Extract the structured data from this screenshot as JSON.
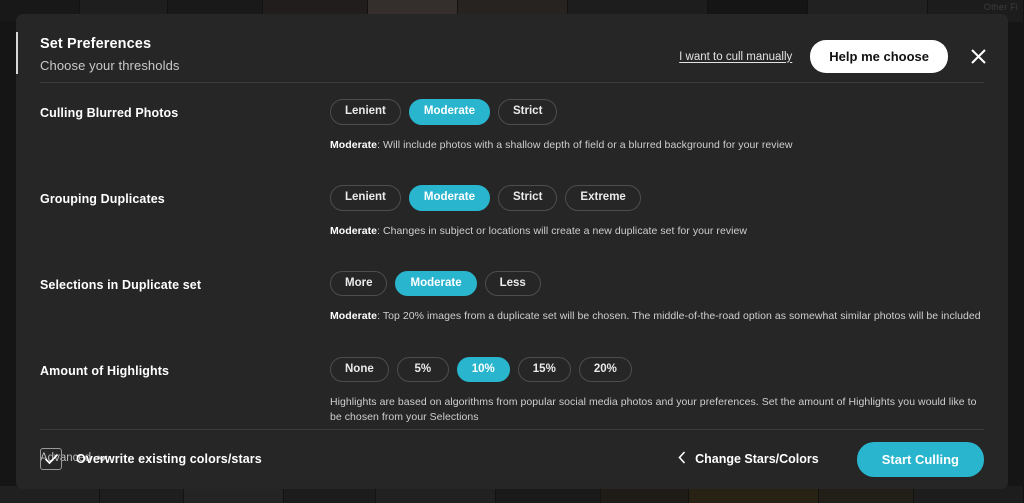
{
  "background": {
    "top_strip_label": "Other Fi",
    "top_thumbs": [
      "#1d1d1d",
      "#232323",
      "#151515",
      "#1e1e1e",
      "#2a2622",
      "#3a3230",
      "#241f1e",
      "#1a1a1a",
      "#202020",
      "#191919"
    ],
    "bottom_thumbs": [
      "#1e1e1e",
      "#242018",
      "#2a2414",
      "#211d17",
      "#1b1b1b",
      "#232323",
      "#1d1d1d",
      "#262626",
      "#1f1f1f",
      "#222222"
    ]
  },
  "header": {
    "title": "Set Preferences",
    "subtitle": "Choose your thresholds",
    "manual_link": "I want to cull manually",
    "help_button": "Help me choose",
    "close_icon": "close-icon"
  },
  "options": [
    {
      "label": "Culling Blurred Photos",
      "choices": [
        "Lenient",
        "Moderate",
        "Strict"
      ],
      "selected": "Moderate",
      "desc_lead": "Moderate",
      "desc_text": ": Will include photos with a shallow depth of field or a blurred background for your review"
    },
    {
      "label": "Grouping Duplicates",
      "choices": [
        "Lenient",
        "Moderate",
        "Strict",
        "Extreme"
      ],
      "selected": "Moderate",
      "desc_lead": "Moderate",
      "desc_text": ": Changes in subject or locations will create a new duplicate set for your review"
    },
    {
      "label": "Selections in Duplicate set",
      "choices": [
        "More",
        "Moderate",
        "Less"
      ],
      "selected": "Moderate",
      "desc_lead": "Moderate",
      "desc_text": ": Top 20% images from a duplicate set will be chosen. The middle-of-the-road option as somewhat similar photos will be included"
    },
    {
      "label": "Amount of Highlights",
      "choices": [
        "None",
        "5%",
        "10%",
        "15%",
        "20%"
      ],
      "selected": "10%",
      "desc_lead": "",
      "desc_text": "Highlights are based on algorithms from popular social media photos and your preferences. Set the amount of Highlights you would like to be chosen from your Selections"
    }
  ],
  "advanced": {
    "label": "Advanced",
    "icon": "chevron-down-icon"
  },
  "footer": {
    "checkbox_label": "Overwrite existing colors/stars",
    "checkbox_checked": true,
    "back_label": "Change Stars/Colors",
    "back_icon": "chevron-left-icon",
    "primary_button": "Start Culling"
  },
  "colors": {
    "accent": "#29b5cd",
    "modal_bg": "#262626",
    "page_bg": "#151515",
    "text": "#ffffff"
  }
}
